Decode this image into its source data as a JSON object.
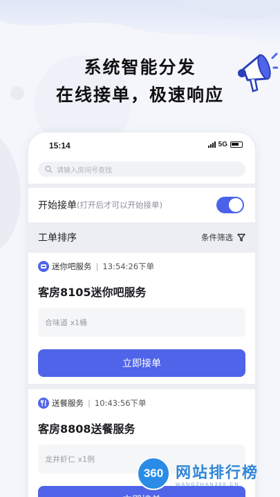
{
  "promo": {
    "headline_line1": "系统智能分发",
    "headline_line2": "在线接单，极速响应"
  },
  "status_bar": {
    "time": "15:14",
    "network": "5G"
  },
  "search": {
    "placeholder": "请输入房间号查找"
  },
  "start_orders": {
    "label": "开始接单",
    "hint": "(打开后才可以开始接单)",
    "enabled": true
  },
  "sort_bar": {
    "label": "工单排序",
    "filter_label": "条件筛选"
  },
  "orders": [
    {
      "service": "迷你吧服务",
      "time": "13:54:26下单",
      "title": "客房8105迷你吧服务",
      "item": "合味道 x1桶",
      "button": "立即接单",
      "icon": "minibar-icon"
    },
    {
      "service": "送餐服务",
      "time": "10:43:56下单",
      "title": "客房8808送餐服务",
      "item": "龙井虾仁 x1例",
      "button": "立即接单",
      "icon": "food-delivery-icon"
    }
  ],
  "watermark": {
    "logo_text": "360",
    "title": "网站排行榜",
    "subtitle": "WANGZHAN360.CN"
  },
  "colors": {
    "accent": "#4f64e8",
    "watermark_blue": "#2f86d8"
  }
}
